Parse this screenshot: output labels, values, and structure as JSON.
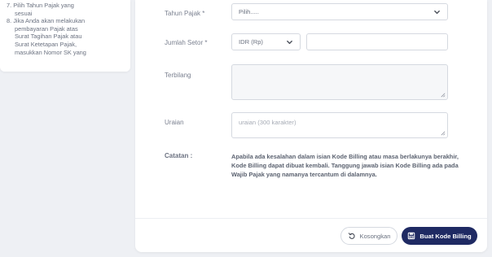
{
  "help": {
    "items": [
      {
        "num": "7.",
        "lines": [
          "Pilih Tahun Pajak yang",
          "sesuai"
        ]
      },
      {
        "num": "8.",
        "lines": [
          "Jika Anda akan melakukan",
          "pembayaran Pajak atas",
          "Surat Tagihan Pajak atau",
          "Surat Ketetapan Pajak,",
          "masukkan Nomor SK yang"
        ]
      }
    ]
  },
  "form": {
    "tahun_pajak": {
      "label": "Tahun Pajak *",
      "value": "Pilih....."
    },
    "jumlah_setor": {
      "label": "Jumlah Setor *",
      "currency": "IDR (Rp)",
      "amount": ""
    },
    "terbilang": {
      "label": "Terbilang",
      "value": ""
    },
    "uraian": {
      "label": "Uraian",
      "placeholder": "uraian (300 karakter)"
    },
    "catatan": {
      "label": "Catatan :",
      "text": "Apabila ada kesalahan dalam isian Kode Billing atau masa berlakunya berakhir, Kode Billing dapat dibuat kembali. Tanggung jawab isian Kode Billing ada pada Wajib Pajak yang namanya tercantum di dalamnya."
    }
  },
  "actions": {
    "reset_label": "Kosongkan",
    "create_label": "Buat Kode Billing"
  },
  "icons": {
    "reset": "undo-icon",
    "create": "save-icon",
    "select": "chevron-down-icon"
  },
  "colors": {
    "primary": "#1f2a63",
    "background": "#eef0f4",
    "textarea_bg": "#f6f7f9"
  }
}
